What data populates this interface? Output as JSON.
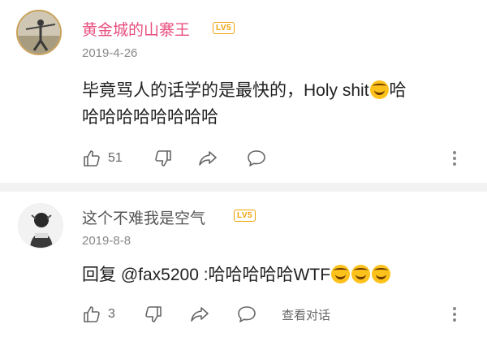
{
  "comments": [
    {
      "username": "黄金城的山寨王",
      "level": "LV5",
      "date": "2019-4-26",
      "text_main": "毕竟骂人的话学的是最快的，Holy shit",
      "text_tail": "哈",
      "text_line2": "哈哈哈哈哈哈哈哈",
      "likes": "51",
      "icons": [
        "thumb-up-icon",
        "thumb-down-icon",
        "share-icon",
        "comment-icon",
        "more-icon"
      ]
    },
    {
      "username": "这个不难我是空气",
      "level": "LV5",
      "date": "2019-8-8",
      "text_main": "回复 @fax5200 :哈哈哈哈哈WTF",
      "likes": "3",
      "view_replies": "查看对话",
      "icons": [
        "thumb-up-icon",
        "thumb-down-icon",
        "share-icon",
        "comment-icon",
        "more-icon"
      ]
    }
  ],
  "colors": {
    "username_primary": "#e84f7f",
    "username_secondary": "#555555",
    "level_badge": "#f0a20a",
    "emoji": "#fcc21b"
  }
}
